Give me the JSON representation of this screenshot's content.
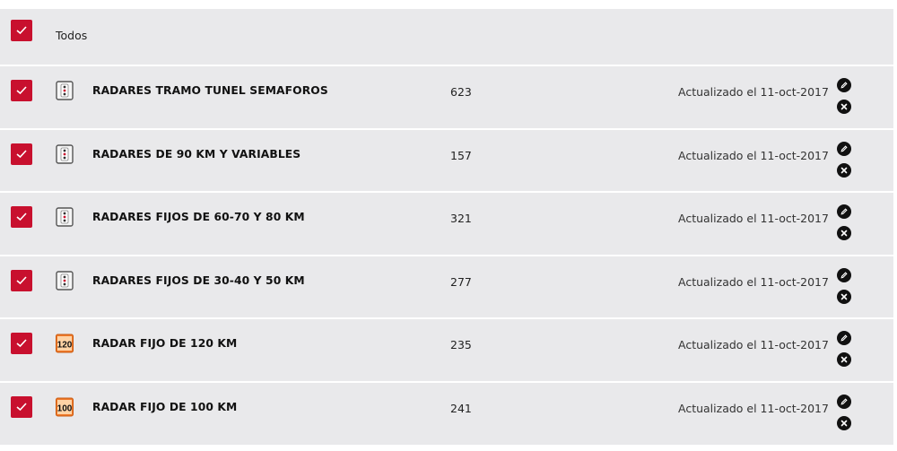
{
  "todos": {
    "label": "Todos"
  },
  "colors": {
    "accent": "#c8102e",
    "row_bg": "#e9e9eb"
  },
  "items": [
    {
      "name": "RADARES TRAMO TUNEL SEMAFOROS",
      "count": "623",
      "updated": "Actualizado el 11-oct-2017",
      "icon": "traffic-light-icon"
    },
    {
      "name": "RADARES DE 90 KM Y VARIABLES",
      "count": "157",
      "updated": "Actualizado el 11-oct-2017",
      "icon": "traffic-light-icon"
    },
    {
      "name": "RADARES FIJOS DE 60-70 Y 80 KM",
      "count": "321",
      "updated": "Actualizado el 11-oct-2017",
      "icon": "traffic-light-icon"
    },
    {
      "name": "RADARES FIJOS DE 30-40 Y 50 KM",
      "count": "277",
      "updated": "Actualizado el 11-oct-2017",
      "icon": "traffic-light-icon"
    },
    {
      "name": "RADAR FIJO DE 120 KM",
      "count": "235",
      "updated": "Actualizado el 11-oct-2017",
      "icon": "speed-sign-icon",
      "speed": "120"
    },
    {
      "name": "RADAR FIJO DE 100 KM",
      "count": "241",
      "updated": "Actualizado el 11-oct-2017",
      "icon": "speed-sign-icon",
      "speed": "100"
    }
  ]
}
